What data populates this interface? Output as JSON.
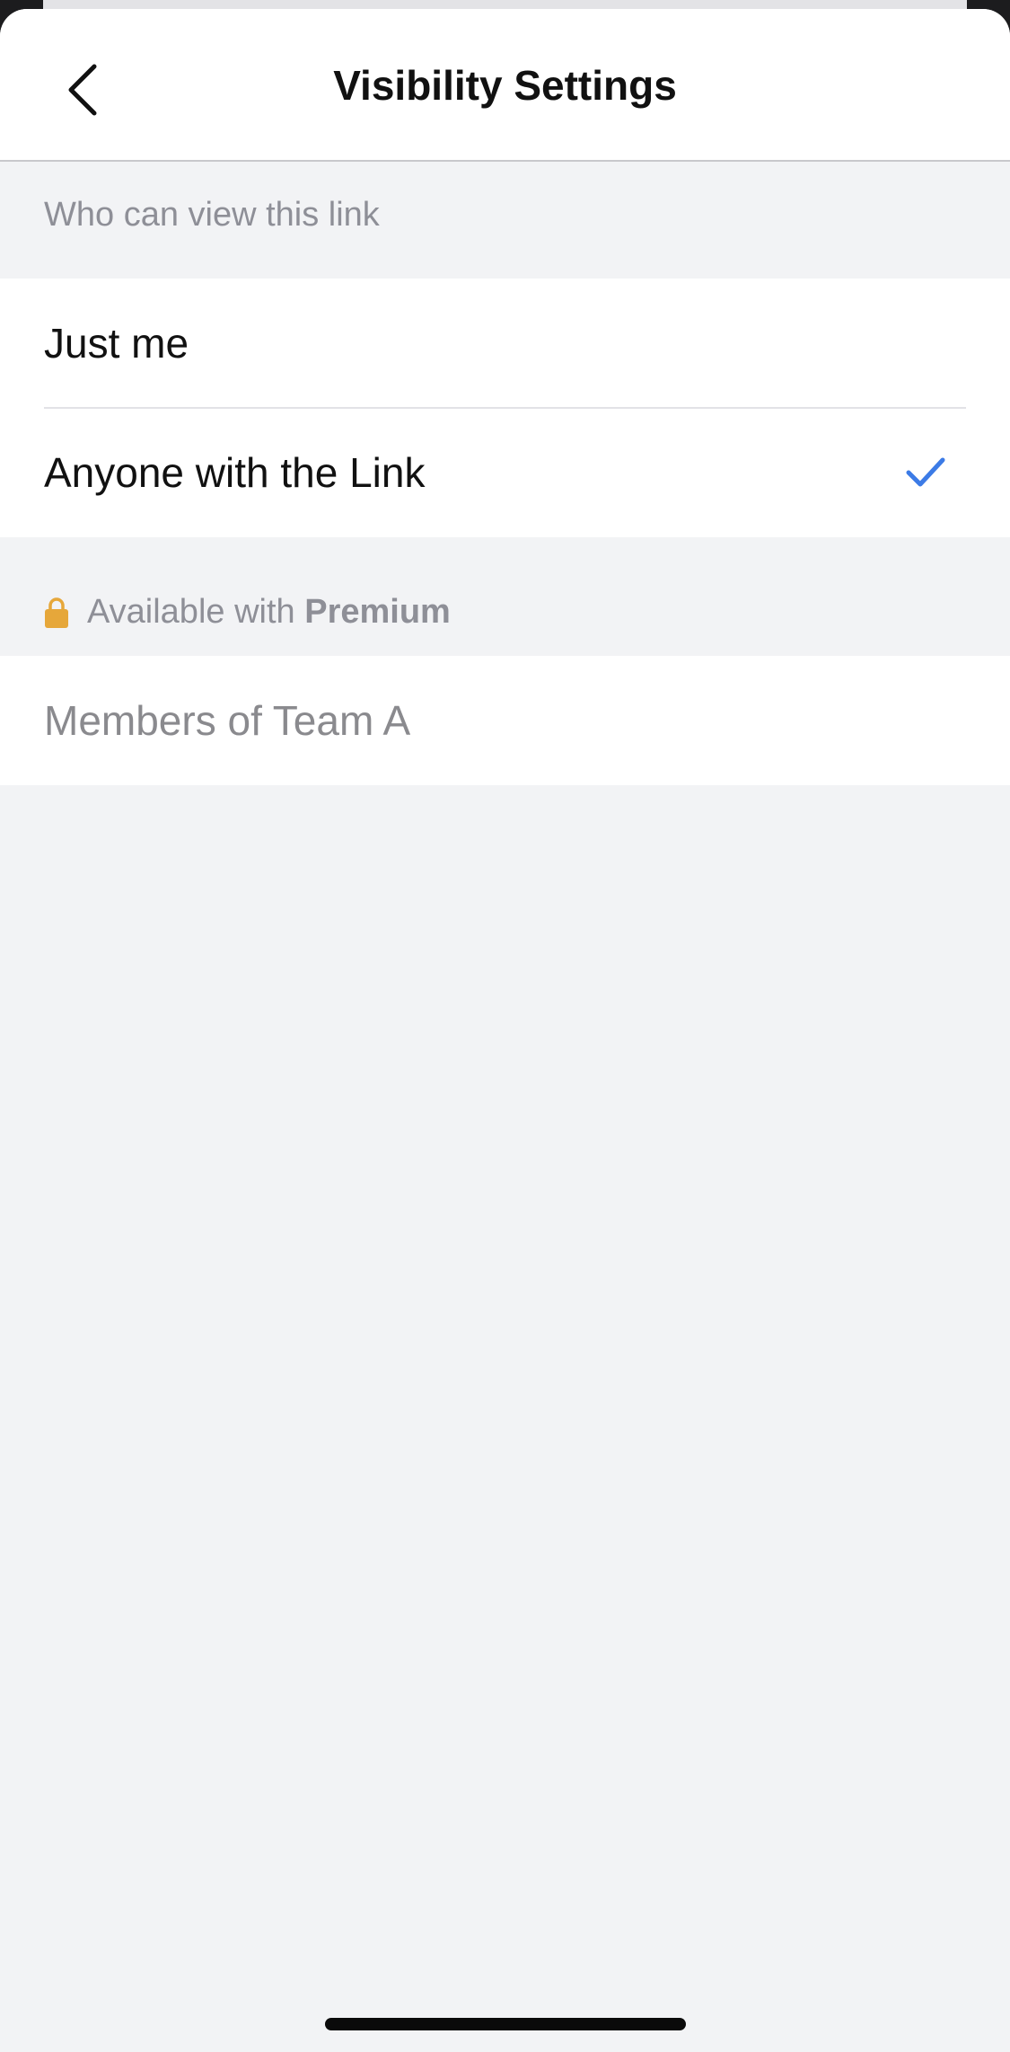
{
  "nav": {
    "title": "Visibility Settings"
  },
  "section_view": {
    "header": "Who can view this link",
    "options": [
      {
        "label": "Just me",
        "selected": false
      },
      {
        "label": "Anyone with the Link",
        "selected": true
      }
    ]
  },
  "section_premium": {
    "prefix": "Available with",
    "plan": "Premium",
    "lock_color": "#E6A73A",
    "options": [
      {
        "label": "Members of Team A",
        "enabled": false
      }
    ]
  },
  "colors": {
    "accent": "#3C7BE6",
    "background": "#F2F3F5"
  },
  "icons": {
    "back": "chevron-left-icon",
    "selected": "checkmark-icon",
    "premium": "lock-icon"
  }
}
